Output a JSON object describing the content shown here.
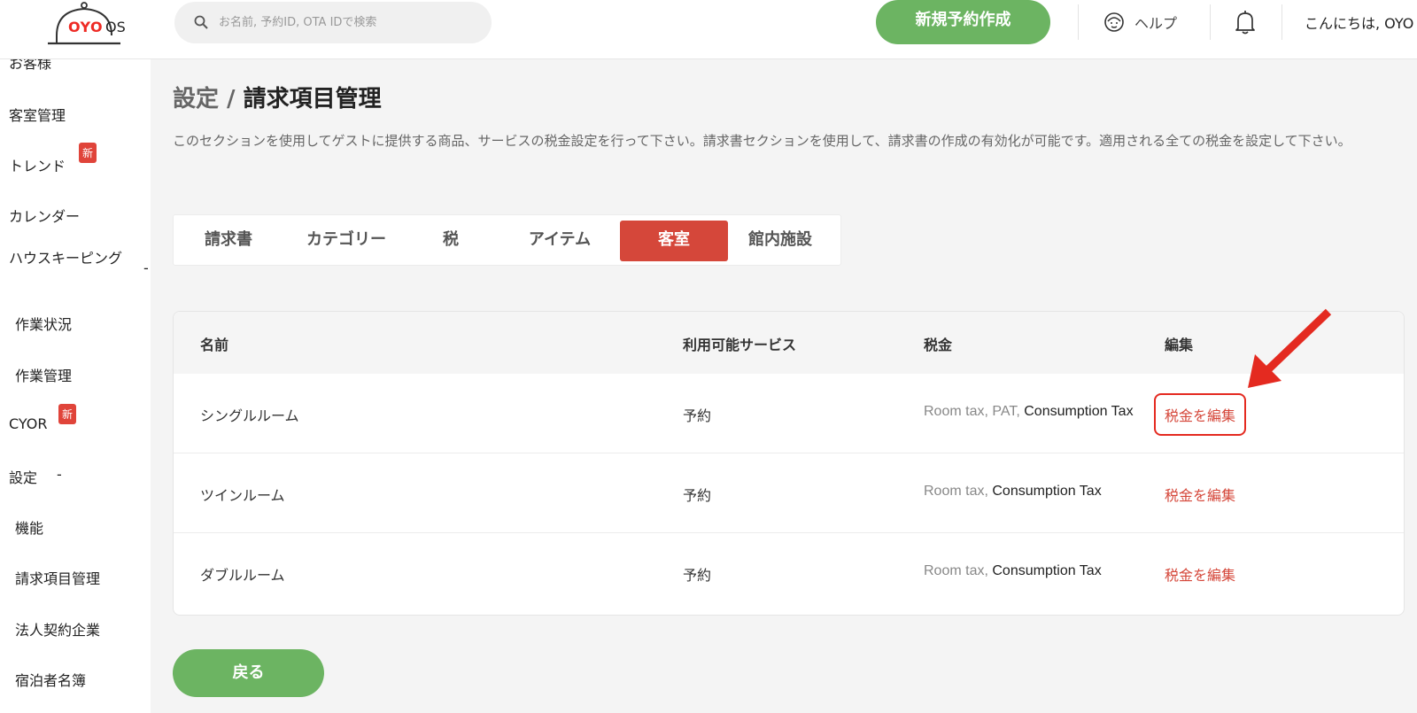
{
  "header": {
    "logo_text": "OYO",
    "logo_suffix": "OS",
    "search_placeholder": "お名前, 予約ID, OTA IDで検索",
    "new_booking_label": "新規予約作成",
    "help_label": "ヘルプ",
    "greeting": "こんにちは, OYO"
  },
  "sidebar": {
    "items": [
      {
        "label": "お客様"
      },
      {
        "label": "客室管理"
      },
      {
        "label": "トレンド",
        "badge": "新"
      },
      {
        "label": "カレンダー"
      },
      {
        "label": "ハウスキーピング",
        "collapse": "-"
      },
      {
        "label": "作業状況"
      },
      {
        "label": "作業管理"
      },
      {
        "label": "CYOR",
        "badge": "新"
      },
      {
        "label": "設定",
        "collapse": "-"
      },
      {
        "label": "機能"
      },
      {
        "label": "請求項目管理"
      },
      {
        "label": "法人契約企業"
      },
      {
        "label": "宿泊者名簿"
      }
    ]
  },
  "main": {
    "breadcrumb": "設定 /",
    "title": "請求項目管理",
    "description": "このセクションを使用してゲストに提供する商品、サービスの税金設定を行って下さい。請求書セクションを使用して、請求書の作成の有効化が可能です。適用される全ての税金を設定して下さい。",
    "tabs": [
      {
        "label": "請求書",
        "active": false
      },
      {
        "label": "カテゴリー",
        "active": false
      },
      {
        "label": "税",
        "active": false
      },
      {
        "label": "アイテム",
        "active": false
      },
      {
        "label": "客室",
        "active": true
      },
      {
        "label": "館内施設",
        "active": false
      }
    ],
    "table": {
      "headers": [
        "名前",
        "利用可能サービス",
        "税金",
        "編集"
      ],
      "rows": [
        {
          "name": "シングルルーム",
          "service": "予約",
          "taxes_dim": "Room tax, PAT,",
          "taxes_strong": "Consumption Tax",
          "edit": "税金を編集"
        },
        {
          "name": "ツインルーム",
          "service": "予約",
          "taxes_dim": "Room tax,",
          "taxes_strong": "Consumption Tax",
          "edit": "税金を編集"
        },
        {
          "name": "ダブルルーム",
          "service": "予約",
          "taxes_dim": "Room tax,",
          "taxes_strong": "Consumption Tax",
          "edit": "税金を編集"
        }
      ]
    },
    "back_label": "戻る"
  },
  "colors": {
    "accent_green": "#6cb462",
    "accent_red": "#d5473a",
    "annotation_red": "#e42a20"
  }
}
